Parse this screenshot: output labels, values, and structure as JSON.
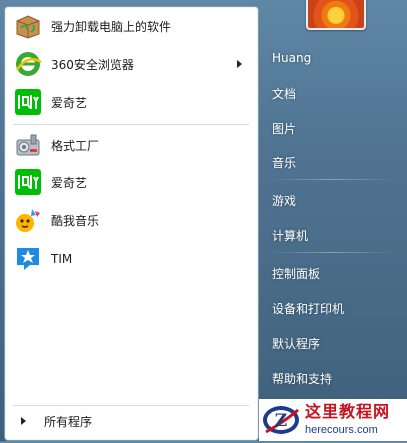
{
  "programs": [
    {
      "label": "强力卸载电脑上的软件",
      "icon": "uninstall-box-icon"
    },
    {
      "label": "360安全浏览器",
      "icon": "360-browser-icon",
      "has_submenu": true
    },
    {
      "label": "爱奇艺",
      "icon": "iqiyi-icon"
    },
    {
      "label": "格式工厂",
      "icon": "format-factory-icon"
    },
    {
      "label": "爱奇艺",
      "icon": "iqiyi-icon"
    },
    {
      "label": "酷我音乐",
      "icon": "kuwo-music-icon"
    },
    {
      "label": "TIM",
      "icon": "tim-icon"
    }
  ],
  "all_programs_label": "所有程序",
  "right_pane": {
    "user_name": "Huang",
    "items": [
      "文档",
      "图片",
      "音乐",
      "游戏",
      "计算机",
      "控制面板",
      "设备和打印机",
      "默认程序",
      "帮助和支持"
    ]
  },
  "watermark": {
    "title": "这里教程网",
    "url": "herecours.com",
    "logo_letter": "Z"
  },
  "colors": {
    "iqiyi_green": "#00be06",
    "browser_green": "#39a935",
    "tim_blue": "#1e8be0",
    "watermark_red": "#c8121d",
    "watermark_blue": "#1f3b8c"
  }
}
